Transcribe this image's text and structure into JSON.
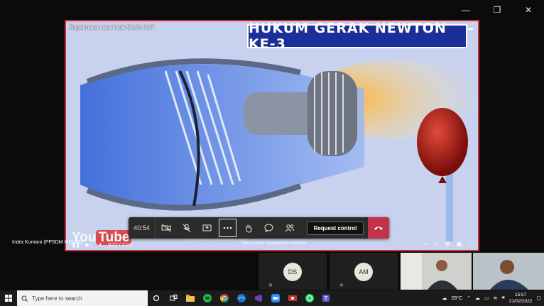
{
  "window": {
    "minimize": "—",
    "restore": "❐",
    "close": "✕"
  },
  "video": {
    "title": "Bagaimana cara kerja Mesin Jet?",
    "banner": "HUKUM GERAK NEWTON KE-3",
    "logo_you": "You",
    "logo_tube": "Tube",
    "watermark": "#inilahkeadyas",
    "progress": "0:27 / 3:24",
    "scroll_hint": "Scroll untuk mengetahui detailnya"
  },
  "callbar": {
    "timer": "40:54",
    "request_control": "Request control",
    "icons": [
      "camera-off-icon",
      "mic-off-icon",
      "share-icon",
      "more-icon",
      "raise-hand-icon",
      "chat-icon",
      "participants-icon"
    ]
  },
  "presenter": "Indra Kumara (PPSDM MIGAS)",
  "participants": [
    {
      "initials": "DS"
    },
    {
      "initials": "AM"
    }
  ],
  "taskbar": {
    "search_placeholder": "Type here to search",
    "weather": "28°C",
    "time": "15:57",
    "date": "21/02/2022"
  },
  "colors": {
    "accent": "#c9303a",
    "banner": "#1c2e9a",
    "hangup": "#c4314b"
  }
}
